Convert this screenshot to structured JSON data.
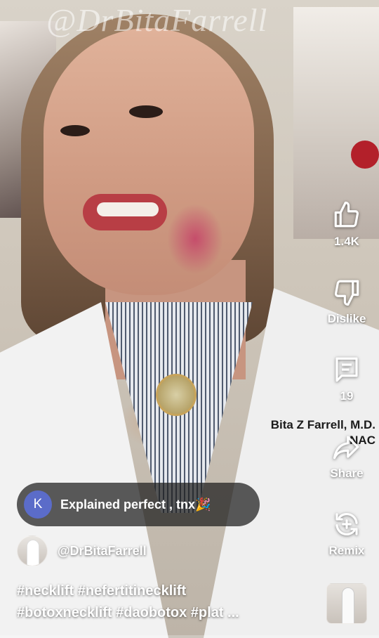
{
  "watermark": "@DrBitaFarrell",
  "coat_embroidery": {
    "line1": "Bita Z Farrell, M.D.",
    "line2": "NAC"
  },
  "actions": {
    "like_count": "1.4K",
    "dislike_label": "Dislike",
    "comment_count": "19",
    "share_label": "Share",
    "remix_label": "Remix"
  },
  "comment": {
    "avatar_letter": "K",
    "text": "Explained perfect , tnx🎉",
    "avatar_color": "#5b6cc9"
  },
  "channel": {
    "handle": "@DrBitaFarrell"
  },
  "description": {
    "line1": "#necklift #nefertitinecklift",
    "line2": "#botoxnecklift #daobotox #plat ..."
  },
  "icons": [
    "thumbs-up-icon",
    "thumbs-down-icon",
    "comment-icon",
    "share-icon",
    "remix-icon"
  ],
  "colors": {
    "accent": "#ff2d2d",
    "text": "#ffffff"
  },
  "playback_progress": 0.0
}
